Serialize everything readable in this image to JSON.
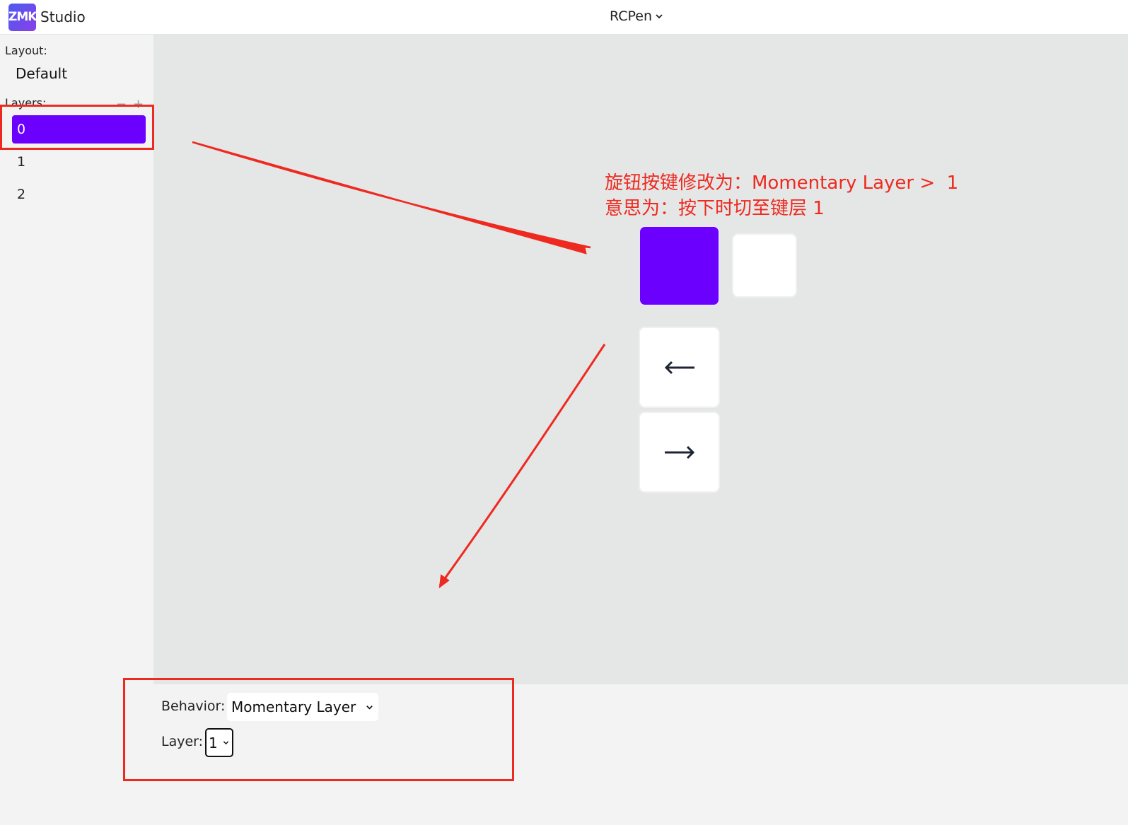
{
  "header": {
    "logo_text": "ZMK",
    "app_name": "Studio",
    "device_name": "RCPen"
  },
  "sidebar": {
    "layout_label": "Layout:",
    "layout_value": "Default",
    "layers_label": "Layers:",
    "remove_layer": "−",
    "add_layer": "+",
    "layers": [
      "0",
      "1",
      "2"
    ],
    "selected_layer": "0"
  },
  "keymap": {
    "keys": [
      {
        "id": "knob-press",
        "label": "",
        "selected": true
      },
      {
        "id": "blank",
        "label": "",
        "selected": false
      },
      {
        "id": "left-arrow",
        "icon": "arrow-left-icon",
        "selected": false
      },
      {
        "id": "right-arrow",
        "icon": "arrow-right-icon",
        "selected": false
      }
    ]
  },
  "annotation": {
    "line1": "旋钮按键修改为：Momentary Layer >  1",
    "line2": "意思为：按下时切至键层 1",
    "color": "#ee2a20"
  },
  "binding": {
    "behavior_label": "Behavior:",
    "behavior_value": "Momentary Layer",
    "layer_label": "Layer:",
    "layer_value": "1"
  },
  "colors": {
    "accent": "#6b00ff",
    "annotation": "#ee2a20"
  }
}
